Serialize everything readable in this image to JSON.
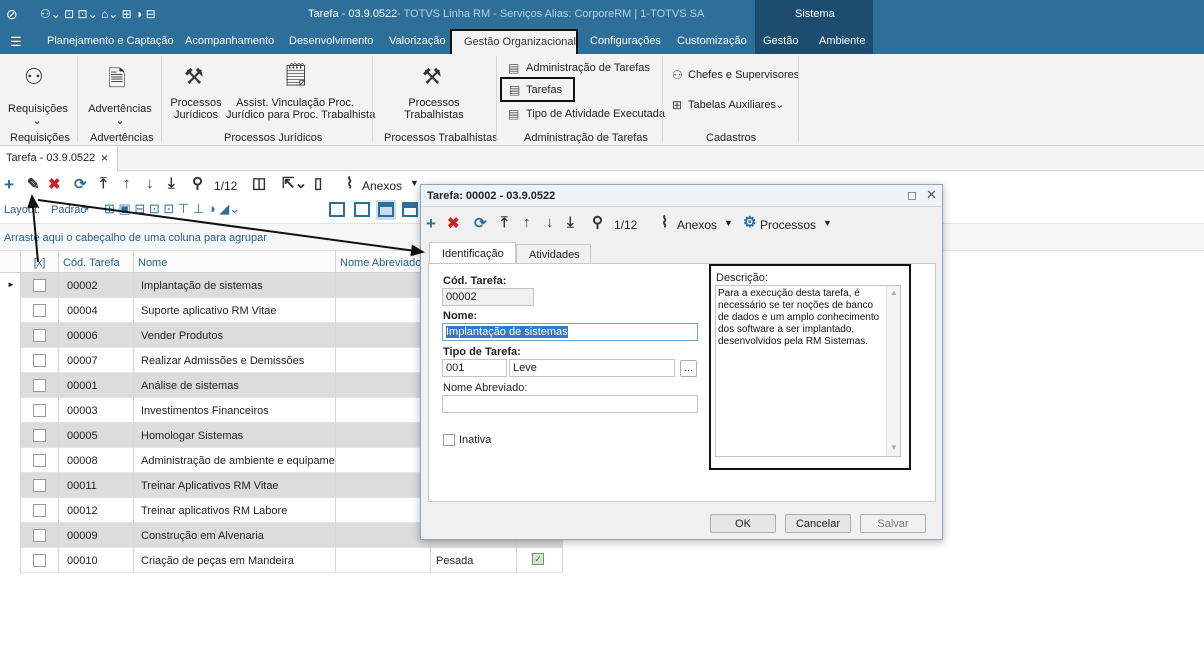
{
  "window": {
    "title": "Tarefa - 03.9.0522",
    "title_suffix": "- TOTVS Linha RM - Serviços  Alias: CorporeRM | 1-TOTVS SA",
    "system": "Sistema"
  },
  "menu": {
    "items": [
      "Planejamento e Captação",
      "Acompanhamento",
      "Desenvolvimento",
      "Valorização",
      "Gestão Organizacional",
      "Configurações",
      "Customização",
      "Gestão",
      "Ambiente"
    ]
  },
  "ribbon": {
    "requisicoes": {
      "label": "Requisições",
      "group": "Requisições"
    },
    "advertencias": {
      "label": "Advertências",
      "group": "Advertências"
    },
    "proc_juridicos": {
      "label1": "Processos",
      "label2": "Jurídicos",
      "assist1": "Assist. Vinculação Proc.",
      "assist2": "Jurídico para Proc. Trabalhista",
      "group": "Processos Jurídicos"
    },
    "proc_trab": {
      "label1": "Processos",
      "label2": "Trabalhistas",
      "group": "Processos Trabalhistas"
    },
    "adm": {
      "item1": "Administração de Tarefas",
      "item2": "Tarefas",
      "item3": "Tipo de Atividade Executada",
      "group": "Administração de Tarefas"
    },
    "cadastros": {
      "item1": "Chefes e Supervisores",
      "item2": "Tabelas Auxiliares",
      "group": "Cadastros"
    }
  },
  "doc_tab": {
    "label": "Tarefa - 03.9.0522",
    "close": "×"
  },
  "toolbar": {
    "counter": "1/12",
    "anexos": "Anexos",
    "processos": "Processos",
    "filtros": "[Filtros]"
  },
  "toolbar2": {
    "layout": "Layout:",
    "padrao": "Padrão"
  },
  "group_hint": "Arraste aqui o cabeçalho de uma coluna para agrupar",
  "grid": {
    "columns": [
      "[x]",
      "Cód. Tarefa",
      "Nome",
      "Nome Abreviado"
    ],
    "rows": [
      {
        "code": "00002",
        "name": "Implantação de sistemas",
        "tipo": ""
      },
      {
        "code": "00004",
        "name": "Suporte aplicativo RM Vitae",
        "tipo": ""
      },
      {
        "code": "00006",
        "name": "Vender Produtos",
        "tipo": ""
      },
      {
        "code": "00007",
        "name": "Realizar Admissões e Demissões",
        "tipo": ""
      },
      {
        "code": "00001",
        "name": "Análise de sistemas",
        "tipo": ""
      },
      {
        "code": "00003",
        "name": "Investimentos Financeiros",
        "tipo": ""
      },
      {
        "code": "00005",
        "name": "Homologar Sistemas",
        "tipo": ""
      },
      {
        "code": "00008",
        "name": "Administração de ambiente e equipamen...",
        "tipo": ""
      },
      {
        "code": "00011",
        "name": "Treinar Aplicativos RM Vitae",
        "tipo": ""
      },
      {
        "code": "00012",
        "name": "Treinar aplicativos RM Labore",
        "tipo": ""
      },
      {
        "code": "00009",
        "name": "Construção em Alvenaria",
        "tipo": ""
      },
      {
        "code": "00010",
        "name": "Criação de peças em Mandeira",
        "tipo": "Pesada"
      }
    ]
  },
  "dialog": {
    "title": "Tarefa: 00002 - 03.9.0522",
    "counter": "1/12",
    "anexos": "Anexos",
    "processos": "Processos",
    "tabs": [
      "Identificação",
      "Atividades"
    ],
    "cod_label": "Cód. Tarefa:",
    "cod_value": "00002",
    "nome_label": "Nome:",
    "nome_value": "Implantação de sistemas",
    "tipo_label": "Tipo de Tarefa:",
    "tipo_code": "001",
    "tipo_name": "Leve",
    "browse": "...",
    "abrev_label": "Nome Abreviado:",
    "abrev_value": "",
    "inativa": "Inativa",
    "desc_label": "Descrição:",
    "desc_value": "Para a execução desta tarefa, é necessário se ter noções de banco de dados e um amplo conhecimento dos software a ser implantado, desenvolvidos pela RM Sistemas.",
    "ok": "OK",
    "cancel": "Cancelar",
    "save": "Salvar"
  },
  "colors": {
    "header_blue": "#2e6f9a",
    "system_dark": "#1c4d70",
    "delete_red": "#c62828"
  }
}
